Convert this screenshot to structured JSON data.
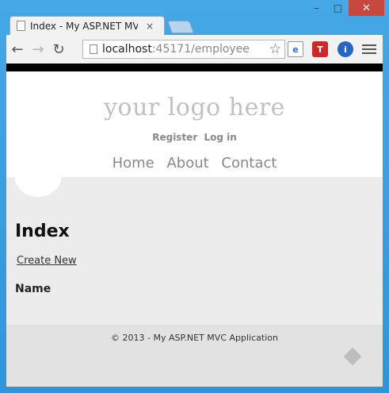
{
  "browser": {
    "tab_title": "Index - My ASP.NET MVC Application",
    "tab_close": "×",
    "url_host": "localhost",
    "url_path": ":45171/employee",
    "window_controls": {
      "minimize": "–",
      "maximize": "□",
      "close": "✕"
    },
    "icons": {
      "back": "←",
      "forward": "→",
      "reload": "↻",
      "star": "☆",
      "ext_ie": "e",
      "ext_t": "T",
      "ext_i": "i"
    }
  },
  "site": {
    "logo": "your logo here",
    "register": "Register",
    "login": "Log in",
    "nav": [
      "Home",
      "About",
      "Contact"
    ]
  },
  "page": {
    "title": "Index",
    "create_link": "Create New",
    "column_name": "Name"
  },
  "footer": {
    "text": "© 2013 - My ASP.NET MVC Application"
  }
}
